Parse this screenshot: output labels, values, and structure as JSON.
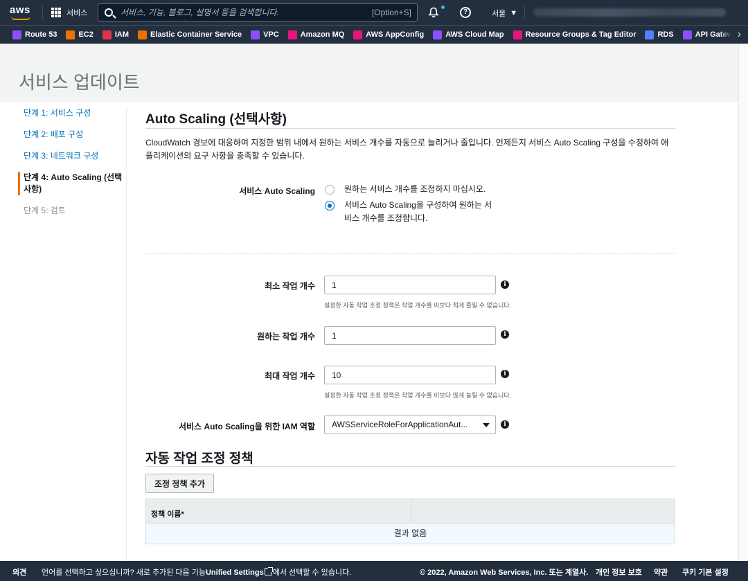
{
  "topbar": {
    "logo_text": "aws",
    "services_label": "서비스",
    "search_placeholder": "서비스, 기능, 블로그, 설명서 등을 검색합니다.",
    "search_shortcut": "[Option+S]",
    "region_label": "서울"
  },
  "favorites": [
    {
      "label": "Route 53",
      "icon": "route53-icon",
      "color": "#8c4fff"
    },
    {
      "label": "EC2",
      "icon": "ec2-icon",
      "color": "#ed7100"
    },
    {
      "label": "IAM",
      "icon": "iam-icon",
      "color": "#dd344c"
    },
    {
      "label": "Elastic Container Service",
      "icon": "ecs-icon",
      "color": "#ed7100"
    },
    {
      "label": "VPC",
      "icon": "vpc-icon",
      "color": "#8c4fff"
    },
    {
      "label": "Amazon MQ",
      "icon": "mq-icon",
      "color": "#e7157b"
    },
    {
      "label": "AWS AppConfig",
      "icon": "appconfig-icon",
      "color": "#e7157b"
    },
    {
      "label": "AWS Cloud Map",
      "icon": "cloudmap-icon",
      "color": "#8c4fff"
    },
    {
      "label": "Resource Groups & Tag Editor",
      "icon": "resource-groups-icon",
      "color": "#e7157b"
    },
    {
      "label": "RDS",
      "icon": "rds-icon",
      "color": "#527fff"
    },
    {
      "label": "API Gatew",
      "icon": "api-gateway-icon",
      "color": "#8c4fff"
    }
  ],
  "page": {
    "title": "서비스 업데이트"
  },
  "steps": [
    {
      "label": "단계 1: 서비스 구성",
      "state": "link"
    },
    {
      "label": "단계 2: 배포 구성",
      "state": "link"
    },
    {
      "label": "단계 3: 네트워크 구성",
      "state": "link"
    },
    {
      "label": "단계 4: Auto Scaling (선택사항)",
      "state": "active"
    },
    {
      "label": "단계 5: 검토",
      "state": "disabled"
    }
  ],
  "autoscaling": {
    "title": "Auto Scaling (선택사항)",
    "description": "CloudWatch 경보에 대응하여 지정한 범위 내에서 원하는 서비스 개수를 자동으로 늘리거나 줄입니다. 언제든지 서비스 Auto Scaling 구성을 수정하여 애플리케이션의 요구 사항을 충족할 수 있습니다.",
    "service_as_label": "서비스 Auto Scaling",
    "option_no": "원하는 서비스 개수를 조정하지 마십시오.",
    "option_yes": "서비스 Auto Scaling을 구성하여 원하는 서비스 개수를 조정합니다.",
    "selected_option": "option_yes",
    "min_label": "최소 작업 개수",
    "min_value": "1",
    "min_hint": "설정한 자동 작업 조정 정책은 작업 개수를 이보다 적게 줄일 수 없습니다.",
    "desired_label": "원하는 작업 개수",
    "desired_value": "1",
    "max_label": "최대 작업 개수",
    "max_value": "10",
    "max_hint": "설정한 자동 작업 조정 정책은 작업 개수를 이보다 많게 늘릴 수 없습니다.",
    "iam_label": "서비스 Auto Scaling을 위한 IAM 역할",
    "iam_value": "AWSServiceRoleForApplicationAut..."
  },
  "policies": {
    "title": "자동 작업 조정 정책",
    "add_button": "조정 정책 추가",
    "columns": [
      "정책 이름*",
      ""
    ],
    "empty_text": "결과 없음"
  },
  "footer": {
    "feedback": "의견",
    "language_prefix": "언어를 선택하고 싶으십니까? 새로 추가된 다음 기능",
    "unified_settings": "Unified Settings",
    "language_suffix": "에서 선택할 수 있습니다.",
    "copyright": "© 2022, Amazon Web Services, Inc. 또는 계열사.",
    "privacy": "개인 정보 보호",
    "terms": "약관",
    "cookies": "쿠키 기본 설정"
  }
}
